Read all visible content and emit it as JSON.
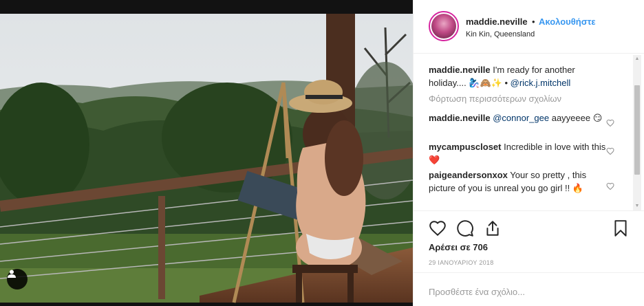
{
  "post": {
    "username": "maddie.neville",
    "separator": "•",
    "follow_label": "Ακολουθήστε",
    "location": "Kin Kin, Queensland"
  },
  "caption": {
    "username": "maddie.neville",
    "text": "I'm ready for another holiday.... 🧞‍♀️🙈✨ •",
    "mention": "@rick.j.mitchell"
  },
  "load_more_label": "Φόρτωση περισσότερων σχολίων",
  "comments": [
    {
      "username": "maddie.neville",
      "mention": "@connor_gee",
      "text": "aayyeeee 😏"
    },
    {
      "username": "mycampuscloset",
      "text": "Incredible in love with this ❤️"
    },
    {
      "username": "paigeandersonxox",
      "text": "Your so pretty , this picture of you is unreal you go girl !! 🔥"
    }
  ],
  "likes_label": "Αρέσει σε 706",
  "date_label": "29 ΙΑΝΟΥΑΡΙΟΥ 2018",
  "add_comment_placeholder": "Προσθέστε ένα σχόλιο...",
  "colors": {
    "link_blue": "#3897f0",
    "mention_blue": "#003569",
    "heart_red": "#ed4956",
    "muted_gray": "#999999"
  },
  "icons": [
    "user-tag-icon",
    "heart-icon",
    "comment-icon",
    "share-icon",
    "bookmark-icon",
    "heart-outline-icon",
    "scroll-up-icon",
    "scroll-down-icon"
  ]
}
